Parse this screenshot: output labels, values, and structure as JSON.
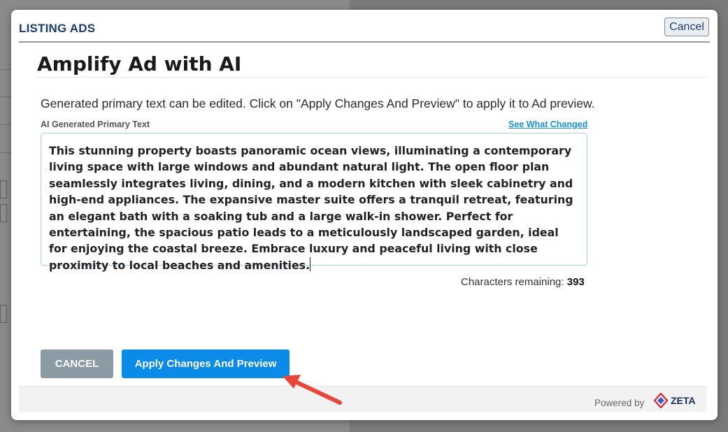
{
  "modal": {
    "title": "LISTING ADS",
    "top_cancel_label": "Cancel"
  },
  "panel": {
    "heading": "Amplify Ad with AI",
    "instructions": "Generated primary text can be edited. Click on \"Apply Changes And Preview\" to apply it to Ad preview.",
    "field_label": "AI Generated Primary Text",
    "see_changed_link": "See What Changed",
    "primary_text": "This stunning property boasts panoramic ocean views, illuminating a contemporary living space with large windows and abundant natural light. The open floor plan seamlessly integrates living, dining, and a modern kitchen with sleek cabinetry and high-end appliances. The expansive master suite offers a tranquil retreat, featuring an elegant bath with a soaking tub and a large walk-in shower. Perfect for entertaining, the spacious patio leads to a meticulously landscaped garden, ideal for enjoying the coastal breeze. Embrace luxury and peaceful living with close proximity to local beaches and amenities.",
    "chars_label": "Characters remaining:",
    "chars_value": "393"
  },
  "actions": {
    "cancel_label": "CANCEL",
    "apply_label": "Apply Changes And Preview"
  },
  "footer": {
    "powered_by": "Powered by",
    "brand": "ZETA"
  },
  "colors": {
    "title": "#1b3d6d",
    "apply_button": "#0b8be8",
    "cancel_button": "#8a9ba4",
    "link": "#1a8fd8",
    "annotation_arrow": "#e8453c"
  },
  "icons": {
    "brand_logo": "zeta-logo-icon",
    "annotation": "red-arrow-icon"
  }
}
